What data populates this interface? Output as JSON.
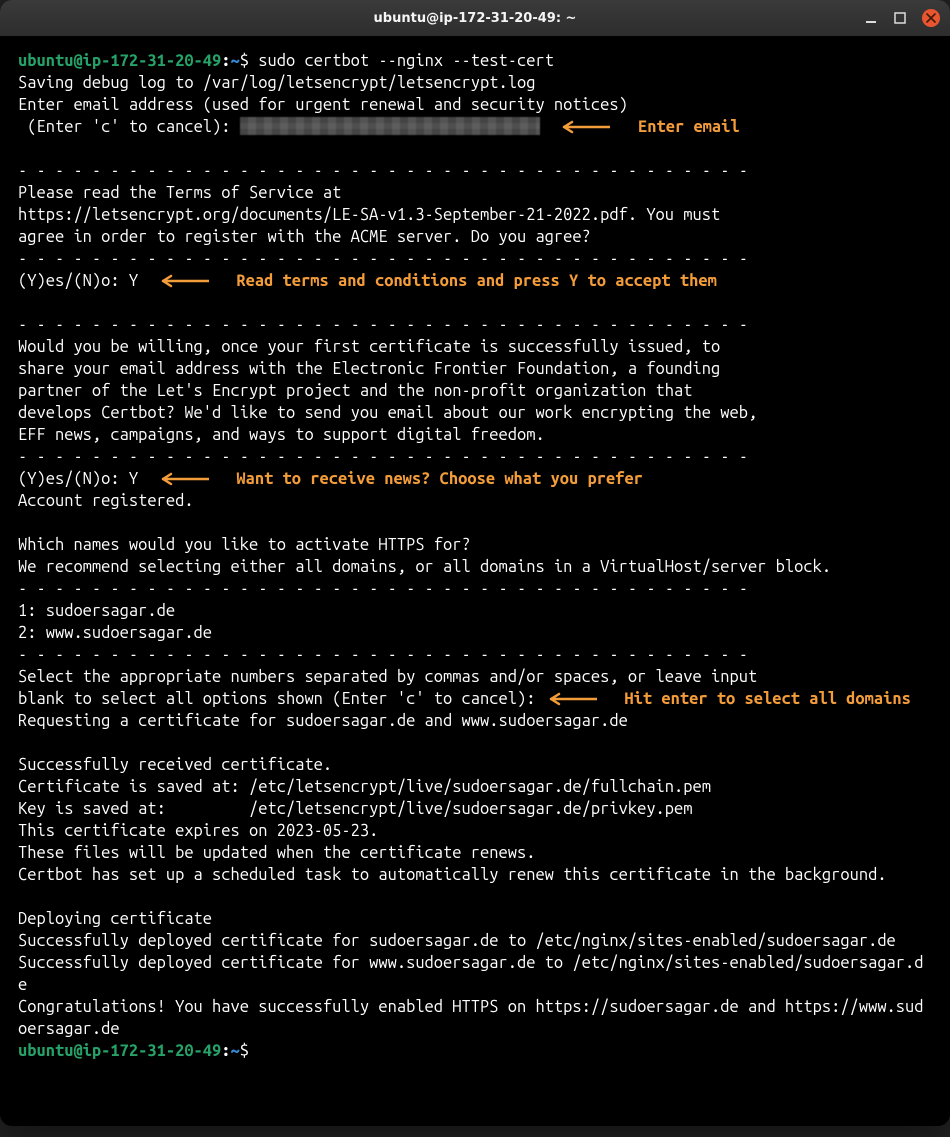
{
  "window": {
    "title": "ubuntu@ip-172-31-20-49: ~"
  },
  "prompt": {
    "user_host": "ubuntu@ip-172-31-20-49",
    "colon": ":",
    "path": "~",
    "dollar": "$"
  },
  "cmd": "sudo certbot --nginx --test-cert",
  "line_saving_log": "Saving debug log to /var/log/letsencrypt/letsencrypt.log",
  "line_enter_email_hdr": "Enter email address (used for urgent renewal and security notices)",
  "line_enter_c_cancel": " (Enter 'c' to cancel): ",
  "ann_enter_email": "Enter email",
  "dashes": "- - - - - - - - - - - - - - - - - - - - - - - - - - - - - - - - - - - - - - - -",
  "tos_l1": "Please read the Terms of Service at",
  "tos_l2": "https://letsencrypt.org/documents/LE-SA-v1.3-September-21-2022.pdf. You must",
  "tos_l3": "agree in order to register with the ACME server. Do you agree?",
  "yesno_prompt": "(Y)es/(N)o: ",
  "yesno_answer": "Y",
  "ann_terms": "Read terms and conditions and press Y to accept them",
  "eff_l1": "Would you be willing, once your first certificate is successfully issued, to",
  "eff_l2": "share your email address with the Electronic Frontier Foundation, a founding",
  "eff_l3": "partner of the Let's Encrypt project and the non-profit organization that",
  "eff_l4": "develops Certbot? We'd like to send you email about our work encrypting the web,",
  "eff_l5": "EFF news, campaigns, and ways to support digital freedom.",
  "ann_news": "Want to receive news? Choose what you prefer",
  "account_registered": "Account registered.",
  "which_l1": "Which names would you like to activate HTTPS for?",
  "which_l2": "We recommend selecting either all domains, or all domains in a VirtualHost/server block.",
  "domain1": "1: sudoersagar.de",
  "domain2": "2: www.sudoersagar.de",
  "select_l1": "Select the appropriate numbers separated by commas and/or spaces, or leave input",
  "select_l2a": "blank to select all options shown (Enter 'c' to cancel): ",
  "ann_enter_all": "Hit enter to select all domains",
  "requesting": "Requesting a certificate for sudoersagar.de and www.sudoersagar.de",
  "succ_recv": "Successfully received certificate.",
  "cert_saved": "Certificate is saved at: /etc/letsencrypt/live/sudoersagar.de/fullchain.pem",
  "key_saved": "Key is saved at:         /etc/letsencrypt/live/sudoersagar.de/privkey.pem",
  "expires": "This certificate expires on 2023-05-23.",
  "update_note": "These files will be updated when the certificate renews.",
  "sched_note": "Certbot has set up a scheduled task to automatically renew this certificate in the background.",
  "deploying": "Deploying certificate",
  "deploy1": "Successfully deployed certificate for sudoersagar.de to /etc/nginx/sites-enabled/sudoersagar.de",
  "deploy2": "Successfully deployed certificate for www.sudoersagar.de to /etc/nginx/sites-enabled/sudoersagar.de",
  "congrats": "Congratulations! You have successfully enabled HTTPS on https://sudoersagar.de and https://www.sudoersagar.de"
}
